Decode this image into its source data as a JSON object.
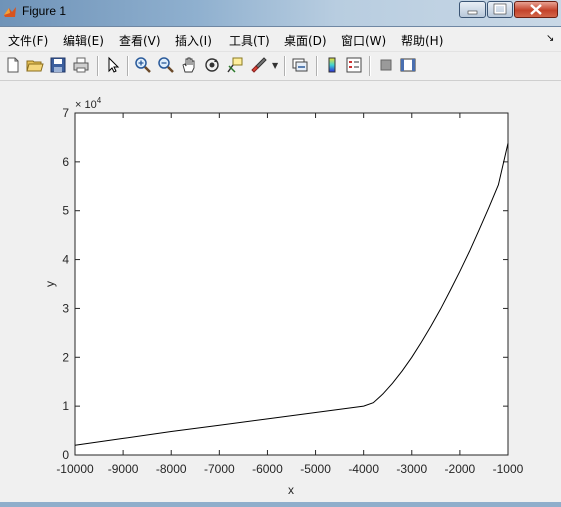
{
  "window": {
    "title": "Figure 1",
    "buttons": [
      "minimize",
      "maximize",
      "close"
    ]
  },
  "menu": {
    "items": [
      "文件(F)",
      "编辑(E)",
      "查看(V)",
      "插入(I)",
      "工具(T)",
      "桌面(D)",
      "窗口(W)",
      "帮助(H)"
    ]
  },
  "toolbar": {
    "icons": [
      "new-figure-icon",
      "open-file-icon",
      "save-icon",
      "print-icon",
      "pointer-icon",
      "zoom-in-icon",
      "zoom-out-icon",
      "pan-icon",
      "rotate-3d-icon",
      "data-cursor-icon",
      "brush-icon",
      "link-plot-icon",
      "colorbar-icon",
      "legend-icon",
      "hide-plot-tools-icon",
      "show-plot-tools-icon"
    ]
  },
  "colors": {
    "background": "#f0f0f0",
    "axes_background": "#ffffff",
    "line": "#000000"
  },
  "chart_data": {
    "type": "line",
    "title": "",
    "xlabel": "x",
    "ylabel": "y",
    "xlim": [
      -10000,
      -1000
    ],
    "ylim": [
      0,
      70000
    ],
    "y_exponent_label": "× 10^4",
    "y_exponent_base": "× 10",
    "y_exponent_power": "4",
    "xticks": [
      -10000,
      -9000,
      -8000,
      -7000,
      -6000,
      -5000,
      -4000,
      -3000,
      -2000,
      -1000
    ],
    "xtick_labels": [
      "-10000",
      "-9000",
      "-8000",
      "-7000",
      "-6000",
      "-5000",
      "-4000",
      "-3000",
      "-2000",
      "-1000"
    ],
    "yticks": [
      0,
      10000,
      20000,
      30000,
      40000,
      50000,
      60000,
      70000
    ],
    "ytick_labels": [
      "0",
      "1",
      "2",
      "3",
      "4",
      "5",
      "6",
      "7"
    ],
    "grid": false,
    "series": [
      {
        "x": [
          -10000,
          -9000,
          -8000,
          -7000,
          -6000,
          -5000,
          -4000,
          -3800,
          -3600,
          -3400,
          -3200,
          -3000,
          -2800,
          -2600,
          -2400,
          -2200,
          -2000,
          -1800,
          -1600,
          -1400,
          -1200,
          -1000
        ],
        "y": [
          2000,
          3400,
          4800,
          6100,
          7400,
          8700,
          10000,
          10700,
          12500,
          14700,
          17200,
          20000,
          23100,
          26400,
          29900,
          33700,
          37600,
          41700,
          46100,
          50600,
          55300,
          63800
        ]
      }
    ]
  }
}
